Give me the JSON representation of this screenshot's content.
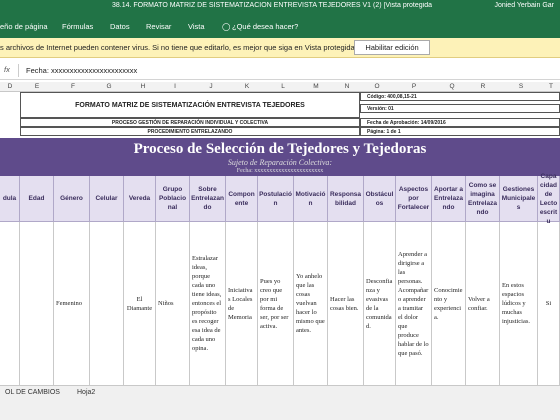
{
  "window": {
    "title": "38.14. FORMATO MATRIZ DE SISTEMATIZACION ENTREVISTA TEJEDORES V1 (2) [Vista protegida] - Excel",
    "user": "Jonied Yerbain Gar"
  },
  "ribbon": {
    "tabs": [
      "eño de página",
      "Fórmulas",
      "Datos",
      "Revisar",
      "Vista"
    ],
    "tellme": "¿Qué desea hacer?"
  },
  "protected_bar": {
    "message": "s archivos de Internet pueden contener virus. Si no tiene que editarlo, es mejor que siga en Vista protegida.",
    "button": "Habilitar edición"
  },
  "formula_bar": {
    "fx": "fx",
    "value": "Fecha: xxxxxxxxxxxxxxxxxxxxxxx"
  },
  "columns": [
    "D",
    "E",
    "F",
    "G",
    "H",
    "I",
    "J",
    "K",
    "L",
    "M",
    "N",
    "O",
    "P",
    "Q",
    "R",
    "S",
    "T"
  ],
  "header": {
    "main_title": "FORMATO MATRIZ DE SISTEMATIZACIÓN ENTREVISTA TEJEDORES",
    "sub1": "PROCESO GESTIÓN DE REPARACIÓN INDIVIDUAL Y COLECTIVA",
    "sub2": "PROCEDIMIENTO ENTRELAZANDO",
    "code": "Código: 400,08,15-21",
    "version": "Versión: 01",
    "approval": "Fecha de Aprobación: 14/09/2016",
    "page": "Página: 1 de 1"
  },
  "banner": {
    "title": "Proceso de Selección de Tejedores y Tejedoras",
    "subtitle": "Sujeto de Reparación Colectiva:",
    "date": "Fecha: xxxxxxxxxxxxxxxxxxxxxxx"
  },
  "table": {
    "headers": [
      "dula",
      "Edad",
      "Género",
      "Celular",
      "Vereda",
      "Grupo Poblacional",
      "Sobre Entrelazando",
      "Componente",
      "Postulación",
      "Motivación",
      "Responsabilidad",
      "Obstáculos",
      "Aspectos por Fortalecer",
      "Aportar a Entrelazando",
      "Como se imagina Entrelazando",
      "Gestiones Municipales",
      "Capacidad de Lectoescritu"
    ],
    "row": [
      "",
      "",
      "Femenino",
      "",
      "El Diamante",
      "Niños",
      "Estralazar ideas, porque cada uno tiene ideas, entonces el propósito es recoger esa idea de cada uno opina.",
      "Iniciativas Locales de Memoria",
      "Pues yo creo que por mi forma de ser, por ser activa.",
      "Yo anhelo que las cosas vuelvan hacer lo mismo que antes.",
      "Hacer las cosas bien.",
      "Desconfianza y evasivas de la comunidad.",
      "Aprender a dirigirse a las personas. Acompañar o aprender a tramitar el dolor que produce hablar de lo que pasó.",
      "Conocimiento y experiencia.",
      "Volver a confiar.",
      "En estos espacios lúdicos y muchas injusticias.",
      "Si"
    ]
  },
  "sheet_tabs": [
    "OL DE CAMBIOS",
    "Hoja2"
  ]
}
